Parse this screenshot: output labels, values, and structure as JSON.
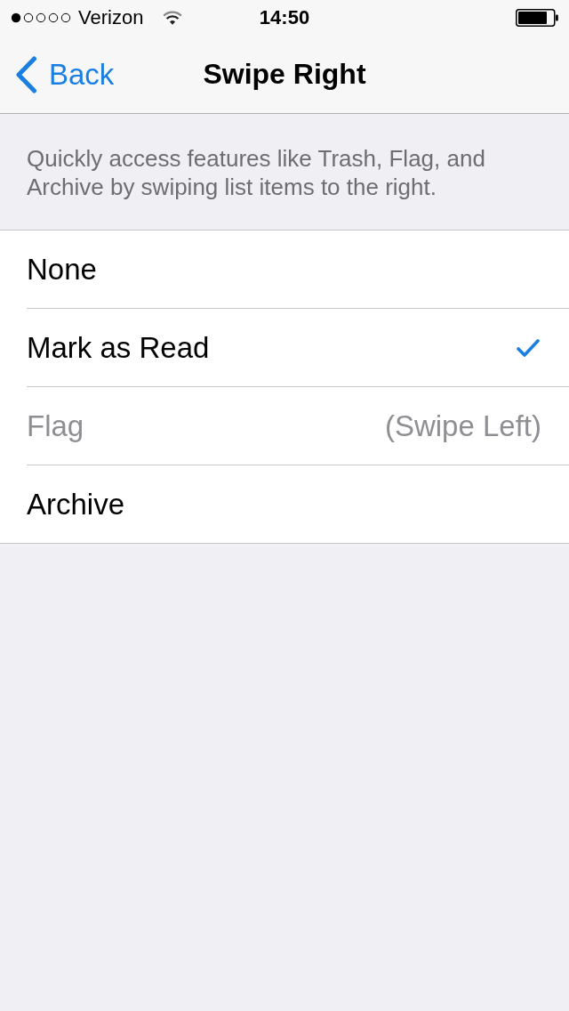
{
  "status_bar": {
    "carrier": "Verizon",
    "time": "14:50"
  },
  "nav_bar": {
    "back": "Back",
    "title": "Swipe Right"
  },
  "description": "Quickly access features like Trash, Flag, and Archive by swiping list items to the right.",
  "options": [
    {
      "label": "None",
      "selected": false,
      "disabled": false
    },
    {
      "label": "Mark as Read",
      "selected": true,
      "disabled": false
    },
    {
      "label": "Flag",
      "selected": false,
      "disabled": true,
      "detail": "(Swipe Left)"
    },
    {
      "label": "Archive",
      "selected": false,
      "disabled": false
    }
  ]
}
